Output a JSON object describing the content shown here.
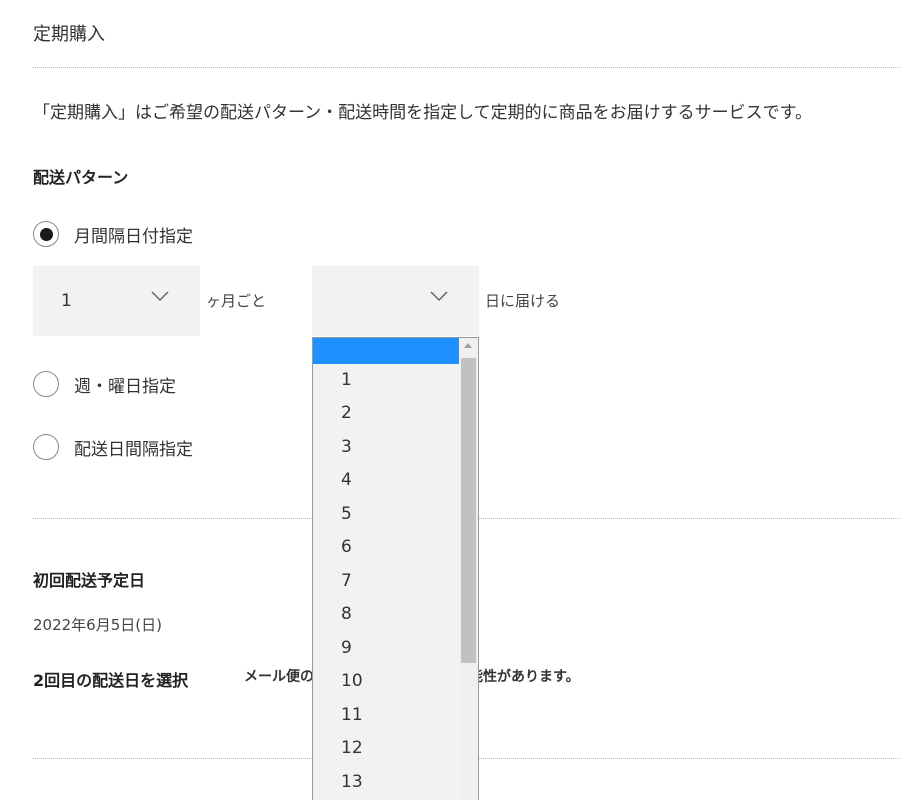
{
  "page": {
    "title": "定期購入",
    "description": "「定期購入」はご希望の配送パターン・配送時間を指定して定期的に商品をお届けするサービスです。"
  },
  "delivery_pattern": {
    "heading": "配送パターン",
    "options": [
      {
        "label": "月間隔日付指定",
        "selected": true
      },
      {
        "label": "週・曜日指定",
        "selected": false
      },
      {
        "label": "配送日間隔指定",
        "selected": false
      }
    ],
    "month_interval": {
      "value": "1",
      "suffix": "ヶ月ごと"
    },
    "day": {
      "value": "",
      "suffix": "日に届ける"
    }
  },
  "day_dropdown": {
    "highlighted_option": "",
    "visible_options": [
      "1",
      "2",
      "3",
      "4",
      "5",
      "6",
      "7",
      "8",
      "9",
      "10",
      "11",
      "12",
      "13"
    ]
  },
  "first_delivery": {
    "heading": "初回配送予定日",
    "date": "2022年6月5日(日)"
  },
  "second_delivery": {
    "heading": "2回目の配送日を選択",
    "note_left": "メール便の",
    "note_right": "能性があります。"
  },
  "colors": {
    "highlight": "#1e90ff",
    "select_bg": "#f2f2f2",
    "divider": "#bdbdbd"
  },
  "icons": {
    "select_arrow": "chevron-down-icon",
    "radio_selected": "radio-checked-icon",
    "radio_unselected": "radio-unchecked-icon"
  }
}
